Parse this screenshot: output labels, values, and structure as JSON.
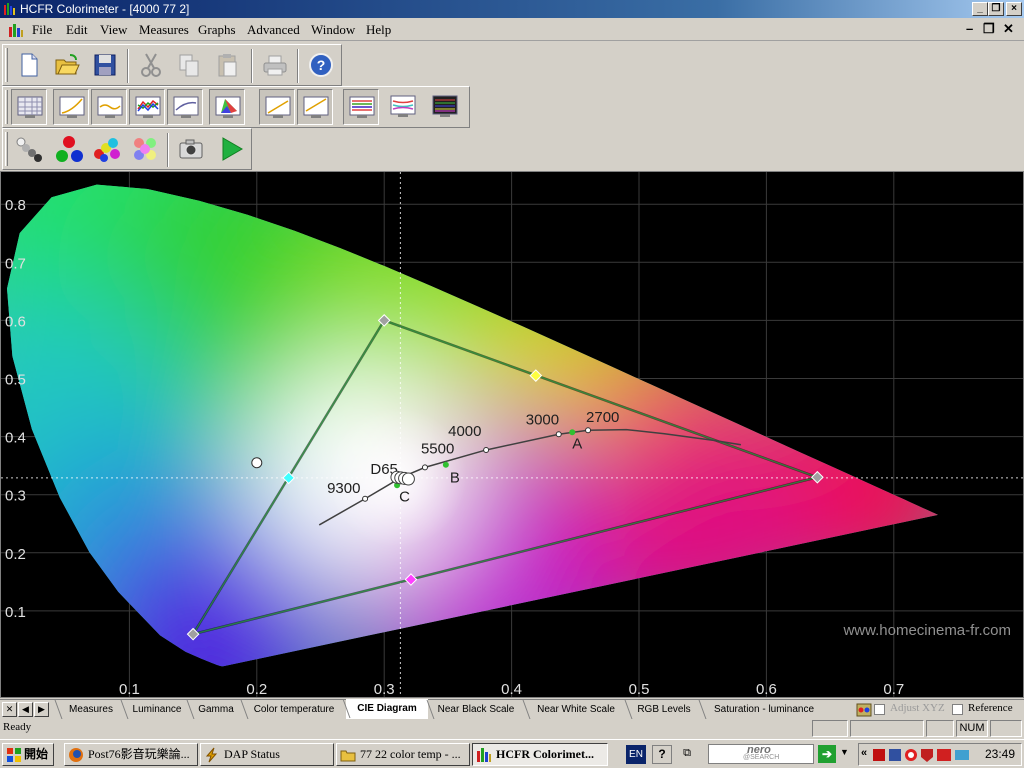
{
  "window": {
    "title": "HCFR Colorimeter - [4000 77 2]"
  },
  "menu": {
    "items": [
      "File",
      "Edit",
      "View",
      "Measures",
      "Graphs",
      "Advanced",
      "Window",
      "Help"
    ]
  },
  "toolbar1": {
    "buttons": [
      "new-document",
      "open-folder",
      "save",
      "cut",
      "copy",
      "paste",
      "print",
      "help"
    ]
  },
  "toolbar2": {
    "buttons": [
      "measures-grid",
      "luminance-graph",
      "gamma-graph",
      "rgb-levels-graph",
      "color-temp-graph",
      "cie-diagram",
      "near-black-graph",
      "near-white-graph",
      "saturation-graph",
      "saturation-multi-graph",
      "all-graphs"
    ]
  },
  "toolbar3": {
    "buttons": [
      "measure-grayscale",
      "measure-primaries",
      "measure-secondaries",
      "measure-saturation",
      "single-measure",
      "continuous-measure"
    ]
  },
  "chart_data": {
    "type": "scatter",
    "subtype": "cie-1931-xy-chromaticity",
    "x_ticks": [
      "0.1",
      "0.2",
      "0.3",
      "0.4",
      "0.5",
      "0.6",
      "0.7"
    ],
    "y_ticks": [
      "0.1",
      "0.2",
      "0.3",
      "0.4",
      "0.5",
      "0.6",
      "0.7",
      "0.8"
    ],
    "xlim": [
      0.0,
      0.8
    ],
    "ylim": [
      0.0,
      0.9
    ],
    "grid": true,
    "watermark": "www.homecinema-fr.com",
    "colors": {
      "background": "#000000",
      "grid": "#3a3a3a",
      "tick_label": "#e0e0e0",
      "gamut_line": "#10a010",
      "planckian": "#404040"
    },
    "reference_gamut": [
      {
        "name": "red",
        "x": 0.64,
        "y": 0.33
      },
      {
        "name": "green",
        "x": 0.3,
        "y": 0.6
      },
      {
        "name": "blue",
        "x": 0.15,
        "y": 0.06
      }
    ],
    "secondaries": [
      {
        "name": "yellow",
        "x": 0.419,
        "y": 0.505,
        "color": "#ffff40"
      },
      {
        "name": "cyan",
        "x": 0.225,
        "y": 0.329,
        "color": "#40ffff"
      },
      {
        "name": "magenta",
        "x": 0.321,
        "y": 0.154,
        "color": "#ff40ff"
      }
    ],
    "planckian_points": [
      {
        "label": "9300",
        "x": 0.285,
        "y": 0.293
      },
      {
        "label": "D65",
        "x": 0.3127,
        "y": 0.329
      },
      {
        "label": "5500",
        "x": 0.332,
        "y": 0.347
      },
      {
        "label": "4000",
        "x": 0.38,
        "y": 0.377
      },
      {
        "label": "3000",
        "x": 0.437,
        "y": 0.404
      },
      {
        "label": "2700",
        "x": 0.46,
        "y": 0.411
      }
    ],
    "illuminants": [
      {
        "label": "A",
        "x": 0.4476,
        "y": 0.4074
      },
      {
        "label": "B",
        "x": 0.3484,
        "y": 0.3516
      },
      {
        "label": "C",
        "x": 0.3101,
        "y": 0.3162
      }
    ],
    "measured_white": [
      {
        "x": 0.31,
        "y": 0.33
      },
      {
        "x": 0.313,
        "y": 0.329
      },
      {
        "x": 0.316,
        "y": 0.328
      },
      {
        "x": 0.319,
        "y": 0.327
      }
    ],
    "outlier_point": {
      "x": 0.2,
      "y": 0.355
    },
    "crosshair": {
      "x": 0.3127,
      "y": 0.329
    }
  },
  "tabs": [
    "Measures",
    "Luminance",
    "Gamma",
    "Color temperature",
    "CIE Diagram",
    "Near Black Scale",
    "Near White Scale",
    "RGB Levels",
    "Saturation - luminance"
  ],
  "active_tab": "CIE Diagram",
  "options": {
    "adjust_xyz": "Adjust XYZ",
    "reference": "Reference"
  },
  "status": {
    "text": "Ready",
    "num": "NUM"
  },
  "taskbar": {
    "start": "開始",
    "tasks": [
      {
        "label": "Post76影音玩樂論...",
        "active": false
      },
      {
        "label": "DAP Status",
        "active": false
      },
      {
        "label": "77 22 color temp - ...",
        "active": false
      },
      {
        "label": "HCFR Colorimet...",
        "active": true
      }
    ],
    "lang": "EN",
    "search_brand": "nero",
    "search_sub": "@SEARCH",
    "clock": "23:49"
  }
}
